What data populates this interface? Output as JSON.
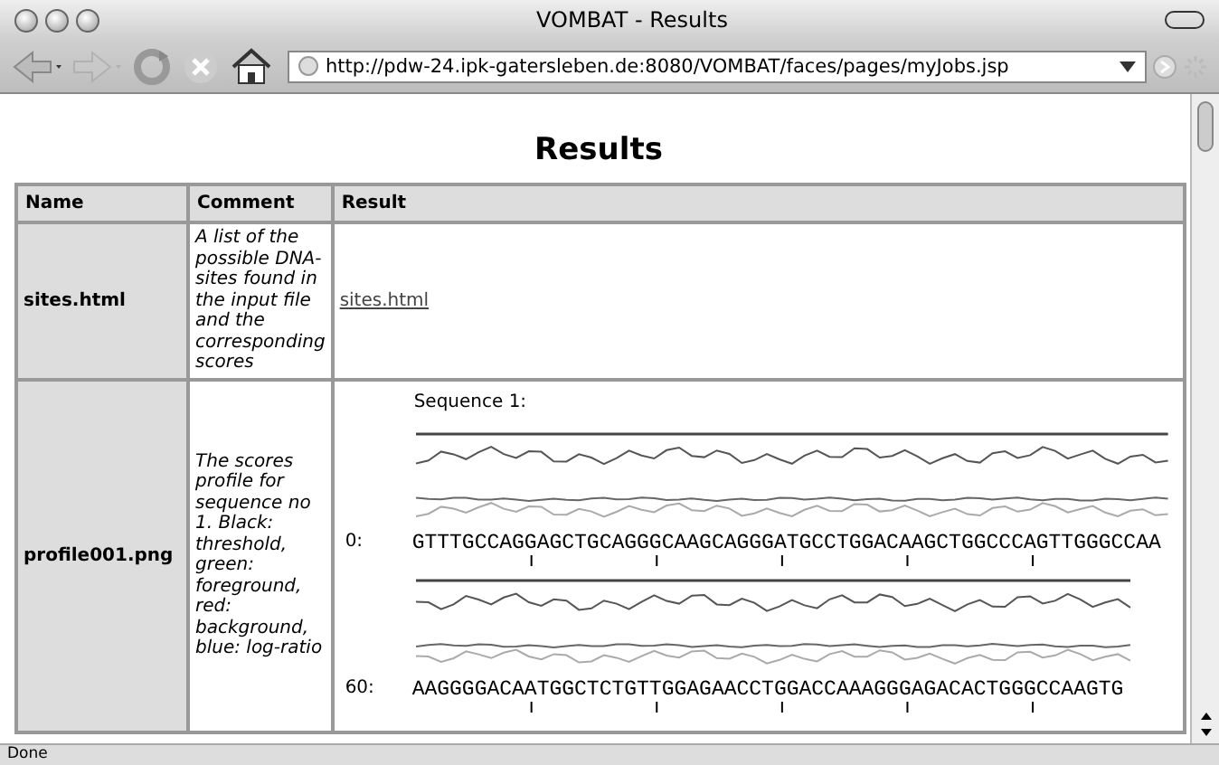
{
  "window": {
    "title": "VOMBAT - Results"
  },
  "toolbar": {
    "url": "http://pdw-24.ipk-gatersleben.de:8080/VOMBAT/faces/pages/myJobs.jsp",
    "forward_disabled": true
  },
  "page": {
    "heading": "Results",
    "table": {
      "columns": [
        "Name",
        "Comment",
        "Result"
      ],
      "rows": [
        {
          "name": "sites.html",
          "comment": "A list of the possible DNA-sites found in the input file and the corresponding scores",
          "result": {
            "kind": "link",
            "text": "sites.html"
          }
        },
        {
          "name": "profile001.png",
          "comment": "The scores profile for sequence no 1. Black: threshold, green: foreground, red: background, blue: log-ratio",
          "result": {
            "kind": "profile",
            "title": "Sequence 1:",
            "lines": [
              {
                "offset": "0:",
                "sequence": "GTTTGCCAGGAGCTGCAGGGCAAGCAGGGATGCCTGGACAAGCTGGCCCAGTTGGGCCAA"
              },
              {
                "offset": "60:",
                "sequence": "AAGGGGACAATGGCTCTGTTGGAGAACCTGGACCAAAGGGAGACACTGGGCCAAGTG"
              }
            ]
          }
        }
      ]
    }
  },
  "status_bar": "Done"
}
